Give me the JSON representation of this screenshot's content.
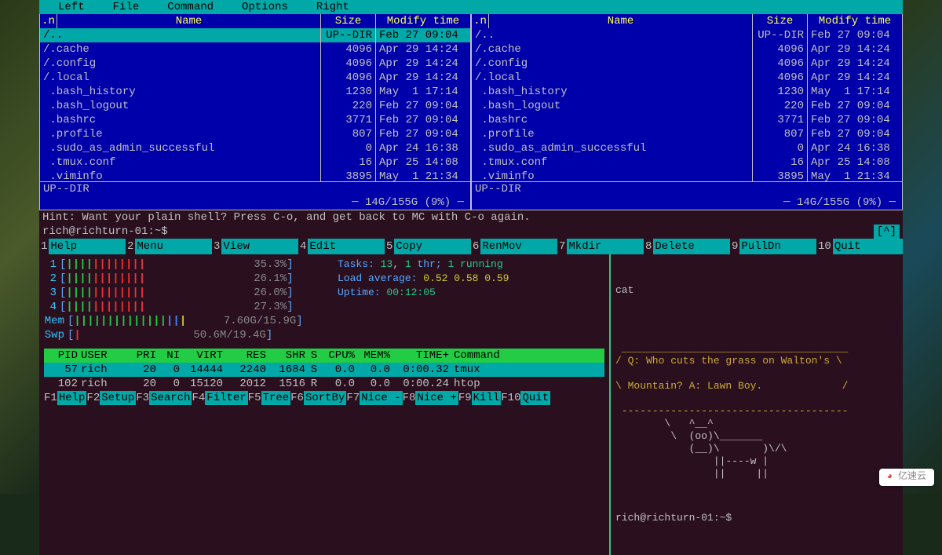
{
  "mc": {
    "menubar": [
      "Left",
      "File",
      "Command",
      "Options",
      "Right"
    ],
    "path_indicator_left": "<-  ~",
    "path_indicator_right": "<-  ~",
    "corner_badge": ".[^]>",
    "columns": {
      "n": ".n",
      "name": "Name",
      "size": "Size",
      "modify": "Modify time"
    },
    "files": [
      {
        "name": "/..",
        "size": "UP--DIR",
        "mod": "Feb 27 09:04",
        "sel": true
      },
      {
        "name": "/.cache",
        "size": "4096",
        "mod": "Apr 29 14:24"
      },
      {
        "name": "/.config",
        "size": "4096",
        "mod": "Apr 29 14:24"
      },
      {
        "name": "/.local",
        "size": "4096",
        "mod": "Apr 29 14:24"
      },
      {
        "name": " .bash_history",
        "size": "1230",
        "mod": "May  1 17:14"
      },
      {
        "name": " .bash_logout",
        "size": "220",
        "mod": "Feb 27 09:04"
      },
      {
        "name": " .bashrc",
        "size": "3771",
        "mod": "Feb 27 09:04"
      },
      {
        "name": " .profile",
        "size": "807",
        "mod": "Feb 27 09:04"
      },
      {
        "name": " .sudo_as_admin_successful",
        "size": "0",
        "mod": "Apr 24 16:38"
      },
      {
        "name": " .tmux.conf",
        "size": "16",
        "mod": "Apr 25 14:08"
      },
      {
        "name": " .viminfo",
        "size": "3895",
        "mod": "May  1 21:34"
      }
    ],
    "status": "UP--DIR",
    "disk": "14G/155G (9%)",
    "hint": "Hint: Want your plain shell? Press C-o, and get back to MC with C-o again.",
    "prompt": "rich@richturn-01:~$",
    "prompt_up": "[^]",
    "fkeys": [
      {
        "n": "1",
        "l": "Help"
      },
      {
        "n": "2",
        "l": "Menu"
      },
      {
        "n": "3",
        "l": "View"
      },
      {
        "n": "4",
        "l": "Edit"
      },
      {
        "n": "5",
        "l": "Copy"
      },
      {
        "n": "6",
        "l": "RenMov"
      },
      {
        "n": "7",
        "l": "Mkdir"
      },
      {
        "n": "8",
        "l": "Delete"
      },
      {
        "n": "9",
        "l": "PullDn"
      },
      {
        "n": "10",
        "l": "Quit"
      }
    ]
  },
  "htop": {
    "cpus": [
      {
        "id": "1",
        "pct": "35.3%"
      },
      {
        "id": "2",
        "pct": "26.1%"
      },
      {
        "id": "3",
        "pct": "26.0%"
      },
      {
        "id": "4",
        "pct": "27.3%"
      }
    ],
    "mem_label": "Mem",
    "mem": "7.60G/15.9G",
    "swp_label": "Swp",
    "swp": "50.6M/19.4G",
    "tasks": "Tasks: 13, 1 thr; 1 running",
    "tasks_num": "13",
    "tasks_thr": "1",
    "tasks_run": "1 running",
    "load": "Load average: 0.52 0.58 0.59",
    "load_vals": "0.52 0.58 0.59",
    "uptime": "Uptime: 00:12:05",
    "uptime_val": "00:12:05",
    "cols": {
      "pid": "PID",
      "user": "USER",
      "pri": "PRI",
      "ni": "NI",
      "virt": "VIRT",
      "res": "RES",
      "shr": "SHR",
      "s": "S",
      "cpu": "CPU%",
      "mem": "MEM%",
      "time": "TIME+",
      "cmd": "Command"
    },
    "procs": [
      {
        "pid": "57",
        "user": "rich",
        "pri": "20",
        "ni": "0",
        "virt": "14444",
        "res": "2240",
        "shr": "1684",
        "s": "S",
        "cpu": "0.0",
        "mem": "0.0",
        "time": "0:00.32",
        "cmd": "tmux",
        "sel": true
      },
      {
        "pid": "102",
        "user": "rich",
        "pri": "20",
        "ni": "0",
        "virt": "15120",
        "res": "2012",
        "shr": "1516",
        "s": "R",
        "cpu": "0.0",
        "mem": "0.0",
        "time": "0:00.24",
        "cmd": "htop"
      }
    ],
    "fkeys": [
      {
        "n": "F1",
        "l": "Help"
      },
      {
        "n": "F2",
        "l": "Setup"
      },
      {
        "n": "F3",
        "l": "Search"
      },
      {
        "n": "F4",
        "l": "Filter"
      },
      {
        "n": "F5",
        "l": "Tree"
      },
      {
        "n": "F6",
        "l": "SortBy"
      },
      {
        "n": "F7",
        "l": "Nice -"
      },
      {
        "n": "F8",
        "l": "Nice +"
      },
      {
        "n": "F9",
        "l": "Kill"
      },
      {
        "n": "F10",
        "l": "Quit"
      }
    ]
  },
  "right": {
    "cmd": "cat",
    "q": "/ Q: Who cuts the grass on Walton's \\",
    "a": "\\ Mountain? A: Lawn Boy.             /",
    "prompt": "rich@richturn-01:~$ "
  },
  "watermark": "亿速云"
}
